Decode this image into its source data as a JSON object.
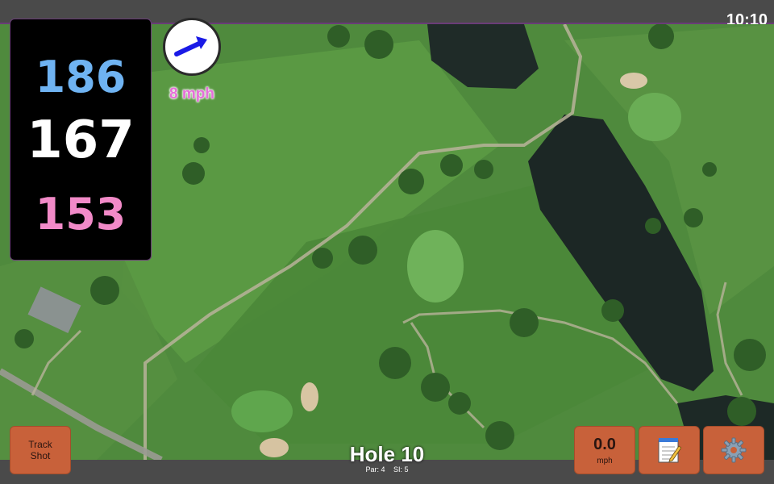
{
  "status_bar": {
    "time": "10:10"
  },
  "distances": {
    "back": "186",
    "middle": "167",
    "front": "153"
  },
  "wind": {
    "speed_label": "8 mph",
    "icon": "arrow-icon",
    "color": "#1a1ae6"
  },
  "hole": {
    "title": "Hole 10",
    "par": "Par: 4",
    "si": "SI: 5"
  },
  "buttons": {
    "track_shot": {
      "line1": "Track",
      "line2": "Shot"
    },
    "speed": {
      "value": "0.0",
      "unit": "mph"
    },
    "notes": {
      "icon": "notepad-icon"
    },
    "settings": {
      "icon": "gear-icon"
    }
  },
  "colors": {
    "back": "#6fb3f2",
    "middle": "#ffffff",
    "front": "#f28ac8",
    "button": "#c8613a",
    "wind_label": "#e66fd9"
  }
}
